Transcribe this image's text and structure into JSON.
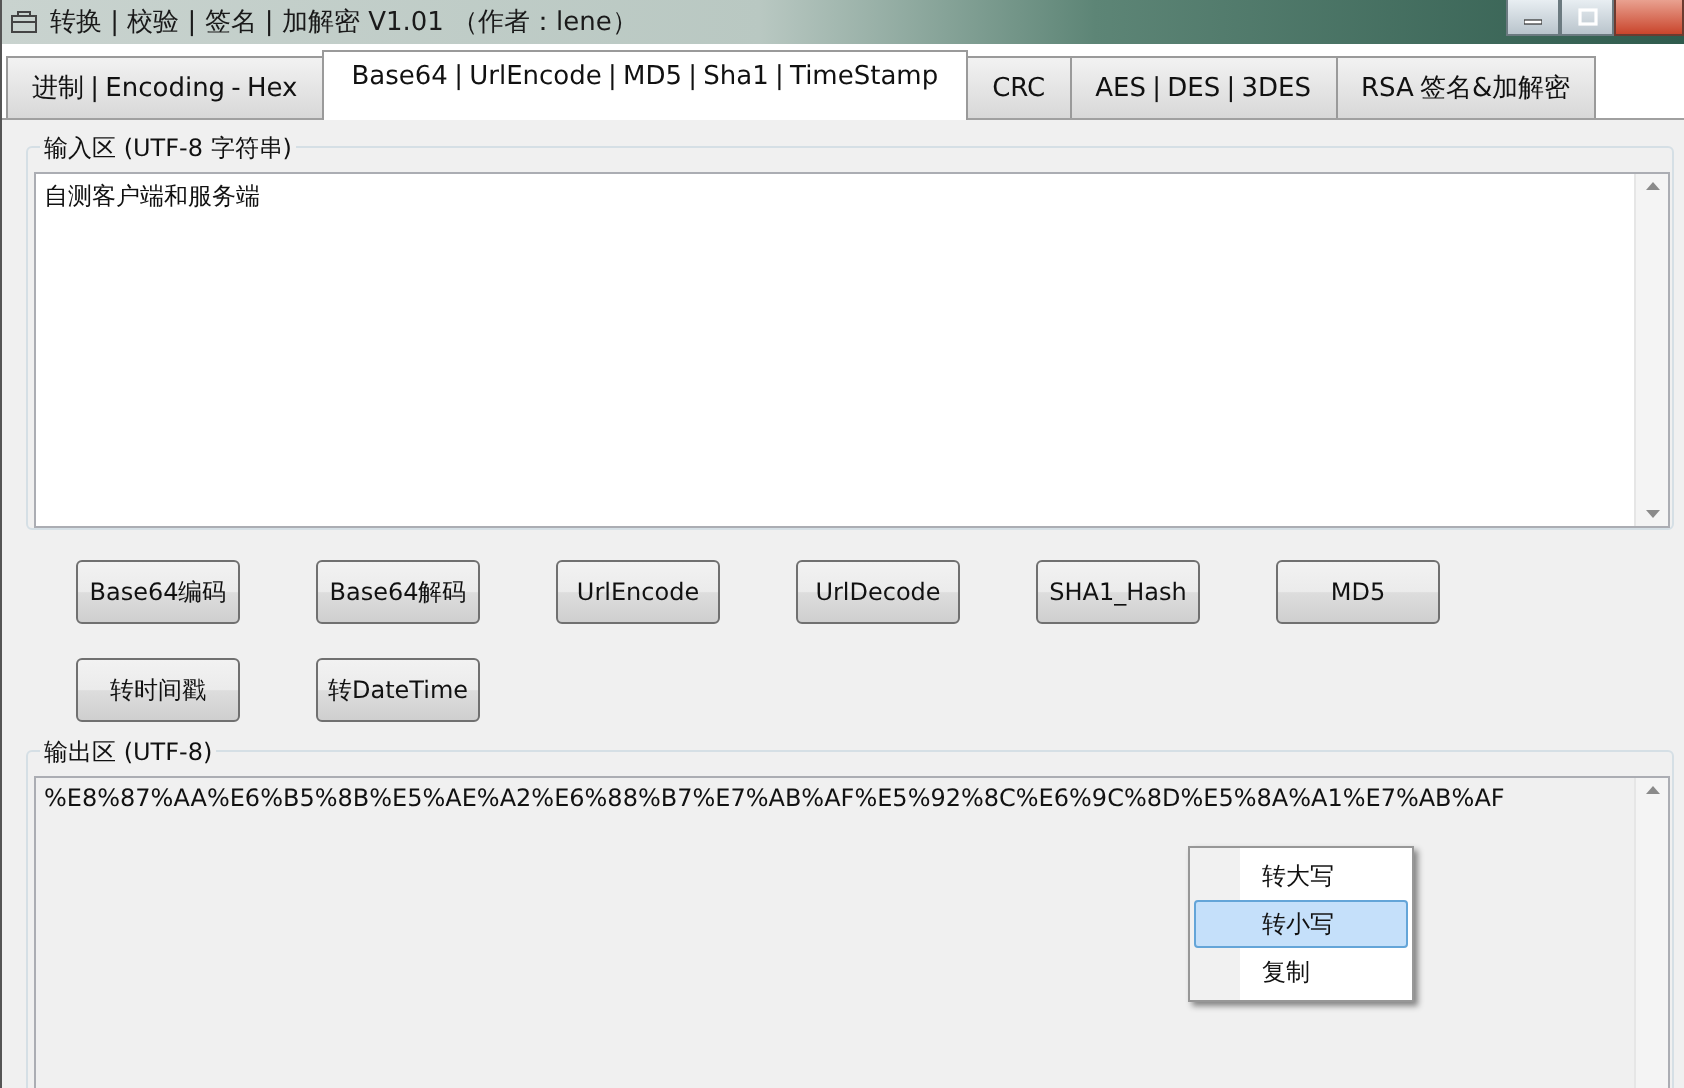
{
  "window": {
    "title": "转换 | 校验 | 签名 | 加解密 V1.01 （作者：lene）"
  },
  "tabs": [
    {
      "label": "进制  |  Encoding - Hex",
      "selected": false
    },
    {
      "label": "Base64  |  UrlEncode  |  MD5  |  Sha1  |  TimeStamp",
      "selected": true
    },
    {
      "label": "CRC",
      "selected": false
    },
    {
      "label": "AES  |  DES  |  3DES",
      "selected": false
    },
    {
      "label": "RSA 签名&加解密",
      "selected": false
    }
  ],
  "input_group": {
    "label": "输入区 (UTF-8 字符串)",
    "value": "自测客户端和服务端"
  },
  "action_buttons": [
    "Base64编码",
    "Base64解码",
    "UrlEncode",
    "UrlDecode",
    "SHA1_Hash",
    "MD5",
    "转时间戳",
    "转DateTime"
  ],
  "output_group": {
    "label": "输出区 (UTF-8)",
    "value": "%E8%87%AA%E6%B5%8B%E5%AE%A2%E6%88%B7%E7%AB%AF%E5%92%8C%E6%9C%8D%E5%8A%A1%E7%AB%AF"
  },
  "context_menu": {
    "items": [
      {
        "label": "转大写",
        "selected": false
      },
      {
        "label": "转小写",
        "selected": true
      },
      {
        "label": "复制",
        "selected": false
      }
    ]
  }
}
